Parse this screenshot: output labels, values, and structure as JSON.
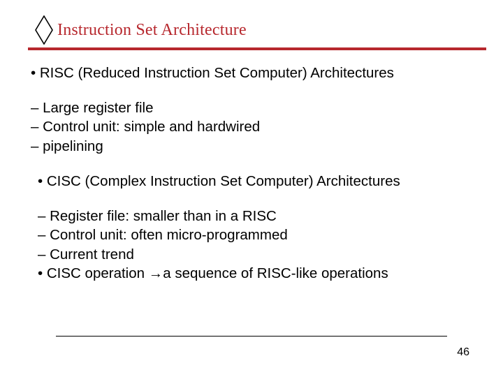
{
  "title": "Instruction Set Architecture",
  "lines": {
    "l1": "• RISC (Reduced Instruction Set Computer) Architectures",
    "l2": "– Large register file",
    "l3": "– Control unit: simple and hardwired",
    "l4": "– pipelining",
    "l5": "• CISC (Complex Instruction Set Computer) Architectures",
    "l6": "– Register file: smaller than in a RISC",
    "l7": "– Control unit: often micro‐programmed",
    "l8": "– Current trend",
    "l9": "• CISC operation →a sequence of RISC‐like operations"
  },
  "page_number": "46",
  "colors": {
    "accent": "#b7282e"
  }
}
